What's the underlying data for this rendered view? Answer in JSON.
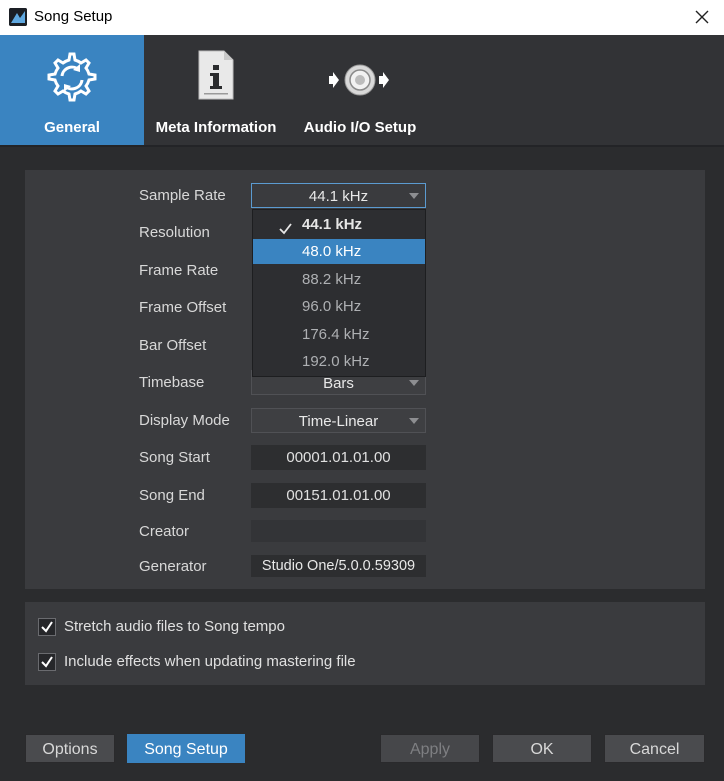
{
  "window": {
    "title": "Song Setup"
  },
  "tabs": [
    {
      "label": "General",
      "icon": "gear-refresh-icon",
      "active": true
    },
    {
      "label": "Meta Information",
      "icon": "info-document-icon",
      "active": false
    },
    {
      "label": "Audio I/O Setup",
      "icon": "audio-io-icon",
      "active": false
    }
  ],
  "settings": {
    "sample_rate": {
      "label": "Sample Rate",
      "value": "44.1 kHz"
    },
    "resolution": {
      "label": "Resolution"
    },
    "frame_rate": {
      "label": "Frame Rate"
    },
    "frame_offset": {
      "label": "Frame Offset"
    },
    "bar_offset": {
      "label": "Bar Offset"
    },
    "timebase": {
      "label": "Timebase",
      "value": "Bars"
    },
    "display_mode": {
      "label": "Display Mode",
      "value": "Time-Linear"
    },
    "song_start": {
      "label": "Song Start",
      "value": "00001.01.01.00"
    },
    "song_end": {
      "label": "Song End",
      "value": "00151.01.01.00"
    },
    "creator": {
      "label": "Creator",
      "value": ""
    },
    "generator": {
      "label": "Generator",
      "value": "Studio One/5.0.0.59309"
    }
  },
  "sample_rate_options": [
    "44.1 kHz",
    "48.0 kHz",
    "88.2 kHz",
    "96.0 kHz",
    "176.4 kHz",
    "192.0 kHz"
  ],
  "sample_rate_checked": "44.1 kHz",
  "sample_rate_hovered": "48.0 kHz",
  "options": {
    "stretch_audio": {
      "label": "Stretch audio files to Song tempo",
      "checked": true
    },
    "include_effects": {
      "label": "Include effects when updating mastering file",
      "checked": true
    }
  },
  "buttons": {
    "options": "Options",
    "song_setup": "Song Setup",
    "apply": "Apply",
    "ok": "OK",
    "cancel": "Cancel"
  },
  "colors": {
    "accent": "#3a84c1",
    "background": "#2b2c2e",
    "panel": "#3a3b3e"
  }
}
